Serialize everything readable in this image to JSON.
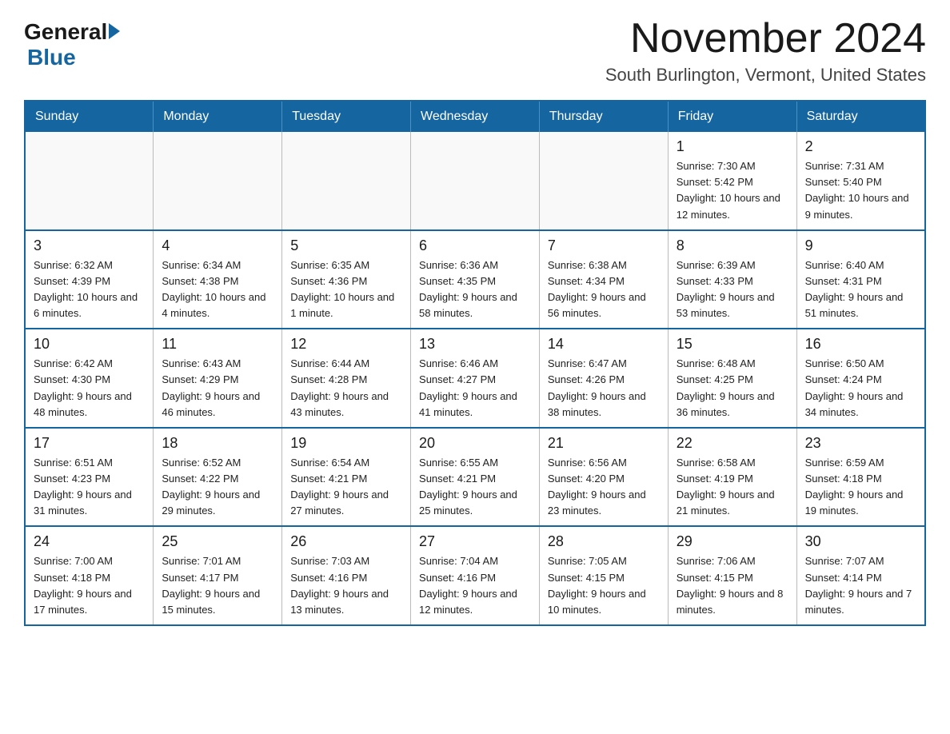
{
  "logo": {
    "general": "General",
    "blue": "Blue"
  },
  "header": {
    "title": "November 2024",
    "subtitle": "South Burlington, Vermont, United States"
  },
  "weekdays": [
    "Sunday",
    "Monday",
    "Tuesday",
    "Wednesday",
    "Thursday",
    "Friday",
    "Saturday"
  ],
  "weeks": [
    [
      {
        "day": "",
        "info": ""
      },
      {
        "day": "",
        "info": ""
      },
      {
        "day": "",
        "info": ""
      },
      {
        "day": "",
        "info": ""
      },
      {
        "day": "",
        "info": ""
      },
      {
        "day": "1",
        "info": "Sunrise: 7:30 AM\nSunset: 5:42 PM\nDaylight: 10 hours and 12 minutes."
      },
      {
        "day": "2",
        "info": "Sunrise: 7:31 AM\nSunset: 5:40 PM\nDaylight: 10 hours and 9 minutes."
      }
    ],
    [
      {
        "day": "3",
        "info": "Sunrise: 6:32 AM\nSunset: 4:39 PM\nDaylight: 10 hours and 6 minutes."
      },
      {
        "day": "4",
        "info": "Sunrise: 6:34 AM\nSunset: 4:38 PM\nDaylight: 10 hours and 4 minutes."
      },
      {
        "day": "5",
        "info": "Sunrise: 6:35 AM\nSunset: 4:36 PM\nDaylight: 10 hours and 1 minute."
      },
      {
        "day": "6",
        "info": "Sunrise: 6:36 AM\nSunset: 4:35 PM\nDaylight: 9 hours and 58 minutes."
      },
      {
        "day": "7",
        "info": "Sunrise: 6:38 AM\nSunset: 4:34 PM\nDaylight: 9 hours and 56 minutes."
      },
      {
        "day": "8",
        "info": "Sunrise: 6:39 AM\nSunset: 4:33 PM\nDaylight: 9 hours and 53 minutes."
      },
      {
        "day": "9",
        "info": "Sunrise: 6:40 AM\nSunset: 4:31 PM\nDaylight: 9 hours and 51 minutes."
      }
    ],
    [
      {
        "day": "10",
        "info": "Sunrise: 6:42 AM\nSunset: 4:30 PM\nDaylight: 9 hours and 48 minutes."
      },
      {
        "day": "11",
        "info": "Sunrise: 6:43 AM\nSunset: 4:29 PM\nDaylight: 9 hours and 46 minutes."
      },
      {
        "day": "12",
        "info": "Sunrise: 6:44 AM\nSunset: 4:28 PM\nDaylight: 9 hours and 43 minutes."
      },
      {
        "day": "13",
        "info": "Sunrise: 6:46 AM\nSunset: 4:27 PM\nDaylight: 9 hours and 41 minutes."
      },
      {
        "day": "14",
        "info": "Sunrise: 6:47 AM\nSunset: 4:26 PM\nDaylight: 9 hours and 38 minutes."
      },
      {
        "day": "15",
        "info": "Sunrise: 6:48 AM\nSunset: 4:25 PM\nDaylight: 9 hours and 36 minutes."
      },
      {
        "day": "16",
        "info": "Sunrise: 6:50 AM\nSunset: 4:24 PM\nDaylight: 9 hours and 34 minutes."
      }
    ],
    [
      {
        "day": "17",
        "info": "Sunrise: 6:51 AM\nSunset: 4:23 PM\nDaylight: 9 hours and 31 minutes."
      },
      {
        "day": "18",
        "info": "Sunrise: 6:52 AM\nSunset: 4:22 PM\nDaylight: 9 hours and 29 minutes."
      },
      {
        "day": "19",
        "info": "Sunrise: 6:54 AM\nSunset: 4:21 PM\nDaylight: 9 hours and 27 minutes."
      },
      {
        "day": "20",
        "info": "Sunrise: 6:55 AM\nSunset: 4:21 PM\nDaylight: 9 hours and 25 minutes."
      },
      {
        "day": "21",
        "info": "Sunrise: 6:56 AM\nSunset: 4:20 PM\nDaylight: 9 hours and 23 minutes."
      },
      {
        "day": "22",
        "info": "Sunrise: 6:58 AM\nSunset: 4:19 PM\nDaylight: 9 hours and 21 minutes."
      },
      {
        "day": "23",
        "info": "Sunrise: 6:59 AM\nSunset: 4:18 PM\nDaylight: 9 hours and 19 minutes."
      }
    ],
    [
      {
        "day": "24",
        "info": "Sunrise: 7:00 AM\nSunset: 4:18 PM\nDaylight: 9 hours and 17 minutes."
      },
      {
        "day": "25",
        "info": "Sunrise: 7:01 AM\nSunset: 4:17 PM\nDaylight: 9 hours and 15 minutes."
      },
      {
        "day": "26",
        "info": "Sunrise: 7:03 AM\nSunset: 4:16 PM\nDaylight: 9 hours and 13 minutes."
      },
      {
        "day": "27",
        "info": "Sunrise: 7:04 AM\nSunset: 4:16 PM\nDaylight: 9 hours and 12 minutes."
      },
      {
        "day": "28",
        "info": "Sunrise: 7:05 AM\nSunset: 4:15 PM\nDaylight: 9 hours and 10 minutes."
      },
      {
        "day": "29",
        "info": "Sunrise: 7:06 AM\nSunset: 4:15 PM\nDaylight: 9 hours and 8 minutes."
      },
      {
        "day": "30",
        "info": "Sunrise: 7:07 AM\nSunset: 4:14 PM\nDaylight: 9 hours and 7 minutes."
      }
    ]
  ]
}
